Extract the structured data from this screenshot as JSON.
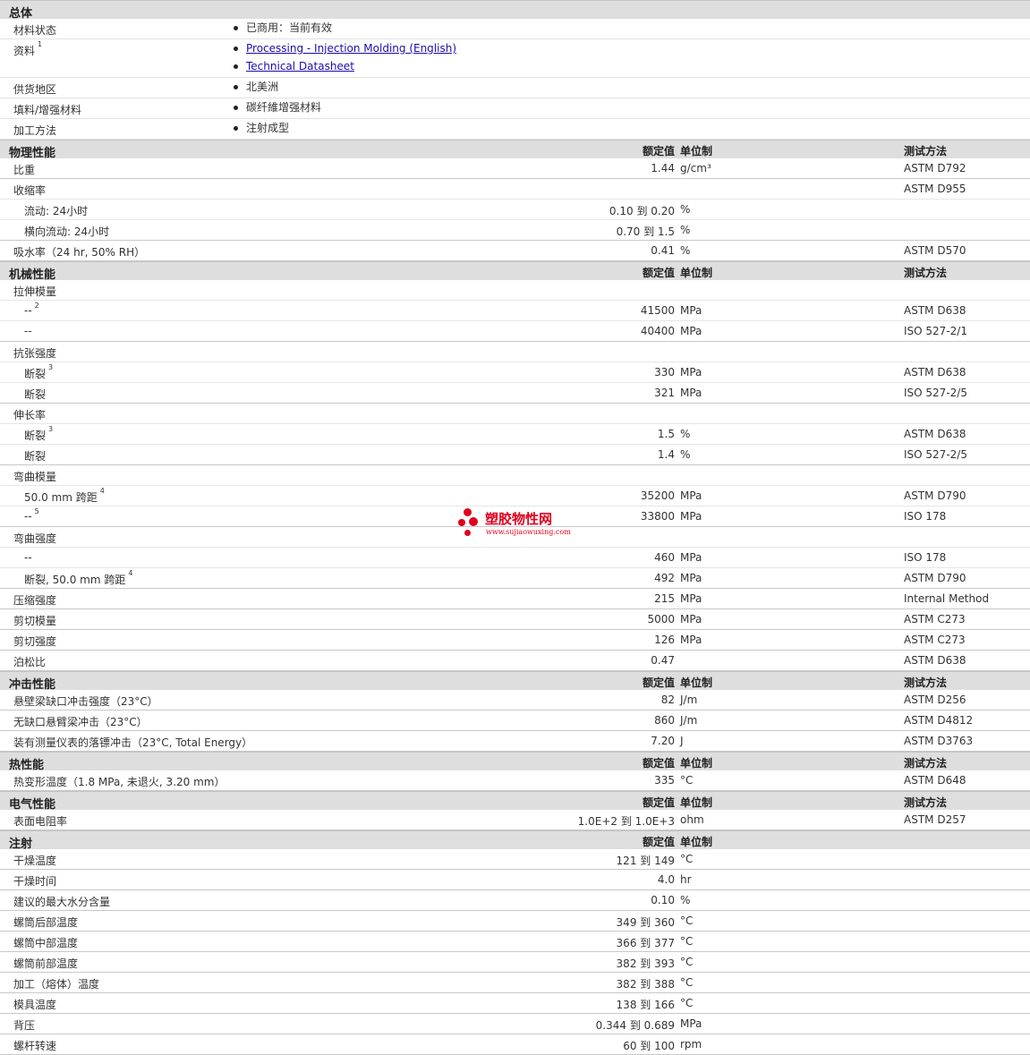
{
  "general": {
    "title": "总体",
    "rows": [
      {
        "label": "材料状态",
        "items": [
          "已商用：当前有效"
        ]
      },
      {
        "label": "资料",
        "sup": "1",
        "links": [
          "Processing - Injection Molding (English)",
          "Technical Datasheet"
        ]
      },
      {
        "label": "供货地区",
        "items": [
          "北美洲"
        ]
      },
      {
        "label": "填料/增强材料",
        "items": [
          "碳纤維增强材料"
        ]
      },
      {
        "label": "加工方法",
        "items": [
          "注射成型"
        ]
      }
    ]
  },
  "sections": [
    {
      "title": "物理性能",
      "h_value": "额定值",
      "h_unit": "单位制",
      "h_method": "测试方法",
      "rows": [
        {
          "label": "比重",
          "value": "1.44",
          "unit": "g/cm³",
          "method": "ASTM D792",
          "type": "grp"
        },
        {
          "label": "收缩率",
          "method": "ASTM D955",
          "type": "head"
        },
        {
          "label": "流动: 24小时",
          "value": "0.10 到  0.20",
          "unit": "%",
          "type": "sub"
        },
        {
          "label": "横向流动: 24小时",
          "value": "0.70 到  1.5",
          "unit": "%",
          "type": "sub",
          "last": true
        },
        {
          "label": "吸水率（24 hr, 50% RH）",
          "value": "0.41",
          "unit": "%",
          "method": "ASTM D570",
          "type": "grp"
        }
      ]
    },
    {
      "title": "机械性能",
      "h_value": "额定值",
      "h_unit": "单位制",
      "h_method": "测试方法",
      "rows": [
        {
          "label": "拉伸模量",
          "type": "head"
        },
        {
          "label": "--",
          "sup": "2",
          "value": "41500",
          "unit": "MPa",
          "method": "ASTM D638",
          "type": "sub"
        },
        {
          "label": "--",
          "value": "40400",
          "unit": "MPa",
          "method": "ISO 527-2/1",
          "type": "sub",
          "last": true
        },
        {
          "label": "抗张强度",
          "type": "head"
        },
        {
          "label": "断裂",
          "sup": "3",
          "value": "330",
          "unit": "MPa",
          "method": "ASTM D638",
          "type": "sub"
        },
        {
          "label": "断裂",
          "value": "321",
          "unit": "MPa",
          "method": "ISO 527-2/5",
          "type": "sub",
          "last": true
        },
        {
          "label": "伸长率",
          "type": "head"
        },
        {
          "label": "断裂",
          "sup": "3",
          "value": "1.5",
          "unit": "%",
          "method": "ASTM D638",
          "type": "sub"
        },
        {
          "label": "断裂",
          "value": "1.4",
          "unit": "%",
          "method": "ISO 527-2/5",
          "type": "sub",
          "last": true
        },
        {
          "label": "弯曲模量",
          "type": "head"
        },
        {
          "label": "50.0 mm 跨距",
          "sup": "4",
          "value": "35200",
          "unit": "MPa",
          "method": "ASTM D790",
          "type": "sub"
        },
        {
          "label": "--",
          "sup": "5",
          "value": "33800",
          "unit": "MPa",
          "method": "ISO 178",
          "type": "sub",
          "last": true
        },
        {
          "label": "弯曲强度",
          "type": "head"
        },
        {
          "label": "--",
          "value": "460",
          "unit": "MPa",
          "method": "ISO 178",
          "type": "sub"
        },
        {
          "label": "断裂, 50.0 mm 跨距",
          "sup": "4",
          "value": "492",
          "unit": "MPa",
          "method": "ASTM D790",
          "type": "sub",
          "last": true
        },
        {
          "label": "压缩强度",
          "value": "215",
          "unit": "MPa",
          "method": "Internal Method",
          "type": "grp"
        },
        {
          "label": "剪切模量",
          "value": "5000",
          "unit": "MPa",
          "method": "ASTM C273",
          "type": "grp"
        },
        {
          "label": "剪切强度",
          "value": "126",
          "unit": "MPa",
          "method": "ASTM C273",
          "type": "grp"
        },
        {
          "label": "泊松比",
          "value": "0.47",
          "method": "ASTM D638",
          "type": "grp"
        }
      ]
    },
    {
      "title": "冲击性能",
      "h_value": "额定值",
      "h_unit": "单位制",
      "h_method": "测试方法",
      "rows": [
        {
          "label": "悬壁梁缺口冲击强度（23°C）",
          "value": "82",
          "unit": "J/m",
          "method": "ASTM D256",
          "type": "grp"
        },
        {
          "label": "无缺口悬臂梁冲击（23°C）",
          "value": "860",
          "unit": "J/m",
          "method": "ASTM D4812",
          "type": "grp"
        },
        {
          "label": "装有测量仪表的落镖冲击（23°C, Total Energy）",
          "value": "7.20",
          "unit": "J",
          "method": "ASTM D3763",
          "type": "grp"
        }
      ]
    },
    {
      "title": "热性能",
      "h_value": "额定值",
      "h_unit": "单位制",
      "h_method": "测试方法",
      "rows": [
        {
          "label": "热变形温度（1.8 MPa, 未退火, 3.20 mm）",
          "value": "335",
          "unit": "°C",
          "method": "ASTM D648",
          "type": "grp"
        }
      ]
    },
    {
      "title": "电气性能",
      "h_value": "额定值",
      "h_unit": "单位制",
      "h_method": "测试方法",
      "rows": [
        {
          "label": "表面电阻率",
          "value": "1.0E+2 到  1.0E+3",
          "unit": "ohm",
          "method": "ASTM D257",
          "type": "grp"
        }
      ]
    },
    {
      "title": "注射",
      "h_value": "额定值",
      "h_unit": "单位制",
      "h_method": "",
      "rows": [
        {
          "label": "干燥温度",
          "value": "121 到  149",
          "unit": "°C",
          "type": "grp"
        },
        {
          "label": "干燥时间",
          "value": "4.0",
          "unit": "hr",
          "type": "grp"
        },
        {
          "label": "建议的最大水分含量",
          "value": "0.10",
          "unit": "%",
          "type": "grp"
        },
        {
          "label": "螺筒后部温度",
          "value": "349 到  360",
          "unit": "°C",
          "type": "grp"
        },
        {
          "label": "螺筒中部温度",
          "value": "366 到  377",
          "unit": "°C",
          "type": "grp"
        },
        {
          "label": "螺筒前部温度",
          "value": "382 到  393",
          "unit": "°C",
          "type": "grp"
        },
        {
          "label": "加工（熔体）温度",
          "value": "382 到  388",
          "unit": "°C",
          "type": "grp"
        },
        {
          "label": "模具温度",
          "value": "138 到  166",
          "unit": "°C",
          "type": "grp"
        },
        {
          "label": "背压",
          "value": "0.344 到  0.689",
          "unit": "MPa",
          "type": "grp"
        },
        {
          "label": "螺杆转速",
          "value": "60 到  100",
          "unit": "rpm",
          "type": "grp"
        }
      ]
    }
  ],
  "watermark": {
    "text": "塑胶物性网",
    "url": "www.sujiaowuxing.com"
  }
}
